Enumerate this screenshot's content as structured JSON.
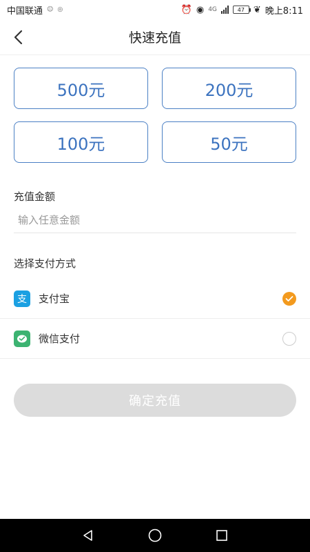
{
  "status": {
    "carrier": "中国联通",
    "network": "4G",
    "battery": "47",
    "time": "晚上8:11"
  },
  "header": {
    "title": "快速充值"
  },
  "amounts": [
    "500元",
    "200元",
    "100元",
    "50元"
  ],
  "recharge": {
    "label": "充值金额",
    "placeholder": "输入任意金额",
    "value": ""
  },
  "payment": {
    "label": "选择支付方式",
    "methods": [
      {
        "name": "支付宝",
        "icon": "alipay-icon",
        "selected": true
      },
      {
        "name": "微信支付",
        "icon": "wechat-pay-icon",
        "selected": false
      }
    ]
  },
  "confirm": {
    "label": "确定充值"
  },
  "colors": {
    "accent_blue": "#3c73bf",
    "selected_orange": "#f39a1e",
    "alipay_blue": "#1ba0e2",
    "wechat_green": "#3cb371",
    "disabled_gray": "#dcdcdc"
  }
}
